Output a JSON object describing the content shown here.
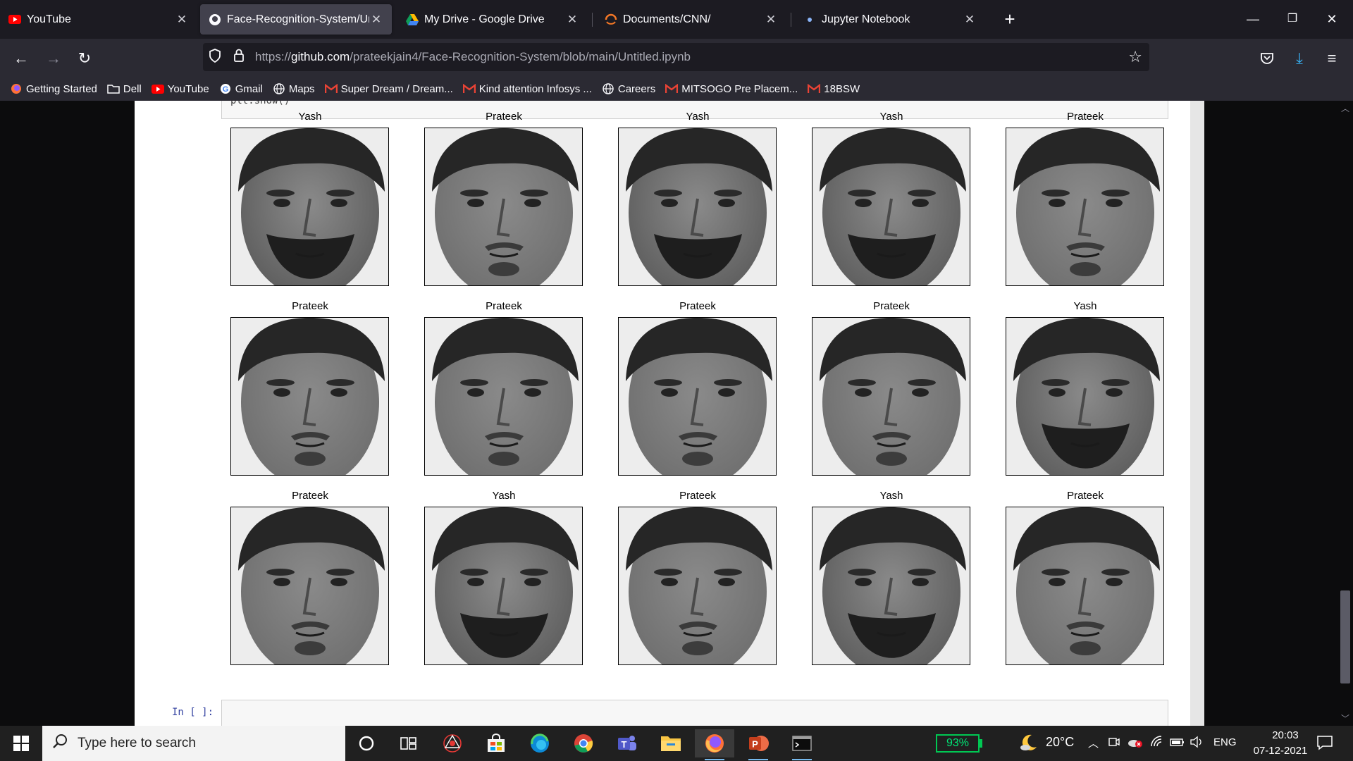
{
  "browser": {
    "tabs": [
      {
        "title": "YouTube",
        "icon": "youtube-icon"
      },
      {
        "title": "Face-Recognition-System/Untitled",
        "icon": "github-icon"
      },
      {
        "title": "My Drive - Google Drive",
        "icon": "google-drive-icon"
      },
      {
        "title": "Documents/CNN/",
        "icon": "jupyter-icon"
      },
      {
        "title": "Jupyter Notebook",
        "icon": "jupyter-icon"
      }
    ],
    "url": {
      "prefix": "https://",
      "host": "github.com",
      "path": "/prateekjain4/Face-Recognition-System/blob/main/Untitled.ipynb"
    },
    "bookmarks": [
      {
        "label": "Getting Started",
        "icon": "firefox-icon"
      },
      {
        "label": "Dell",
        "icon": "folder-icon"
      },
      {
        "label": "YouTube",
        "icon": "youtube-icon"
      },
      {
        "label": "Gmail",
        "icon": "google-icon"
      },
      {
        "label": "Maps",
        "icon": "globe-icon"
      },
      {
        "label": "Super Dream / Dream...",
        "icon": "gmail-icon"
      },
      {
        "label": "Kind attention Infosys ...",
        "icon": "gmail-icon"
      },
      {
        "label": "Careers",
        "icon": "globe-icon"
      },
      {
        "label": "MITSOGO Pre Placem...",
        "icon": "gmail-icon"
      },
      {
        "label": "18BSW",
        "icon": "gmail-icon"
      }
    ]
  },
  "notebook": {
    "code_tail": "plt.show()",
    "input_prompt": "In [ ]:",
    "faces": [
      {
        "label": "Yash",
        "beard": true
      },
      {
        "label": "Prateek",
        "beard": false
      },
      {
        "label": "Yash",
        "beard": true
      },
      {
        "label": "Yash",
        "beard": true
      },
      {
        "label": "Prateek",
        "beard": false
      },
      {
        "label": "Prateek",
        "beard": false
      },
      {
        "label": "Prateek",
        "beard": false
      },
      {
        "label": "Prateek",
        "beard": false
      },
      {
        "label": "Prateek",
        "beard": false
      },
      {
        "label": "Yash",
        "beard": true
      },
      {
        "label": "Prateek",
        "beard": false
      },
      {
        "label": "Yash",
        "beard": true
      },
      {
        "label": "Prateek",
        "beard": false
      },
      {
        "label": "Yash",
        "beard": true
      },
      {
        "label": "Prateek",
        "beard": false
      }
    ]
  },
  "taskbar": {
    "search_placeholder": "Type here to search",
    "battery": "93%",
    "temperature": "20°C",
    "language": "ENG",
    "time": "20:03",
    "date": "07-12-2021"
  }
}
